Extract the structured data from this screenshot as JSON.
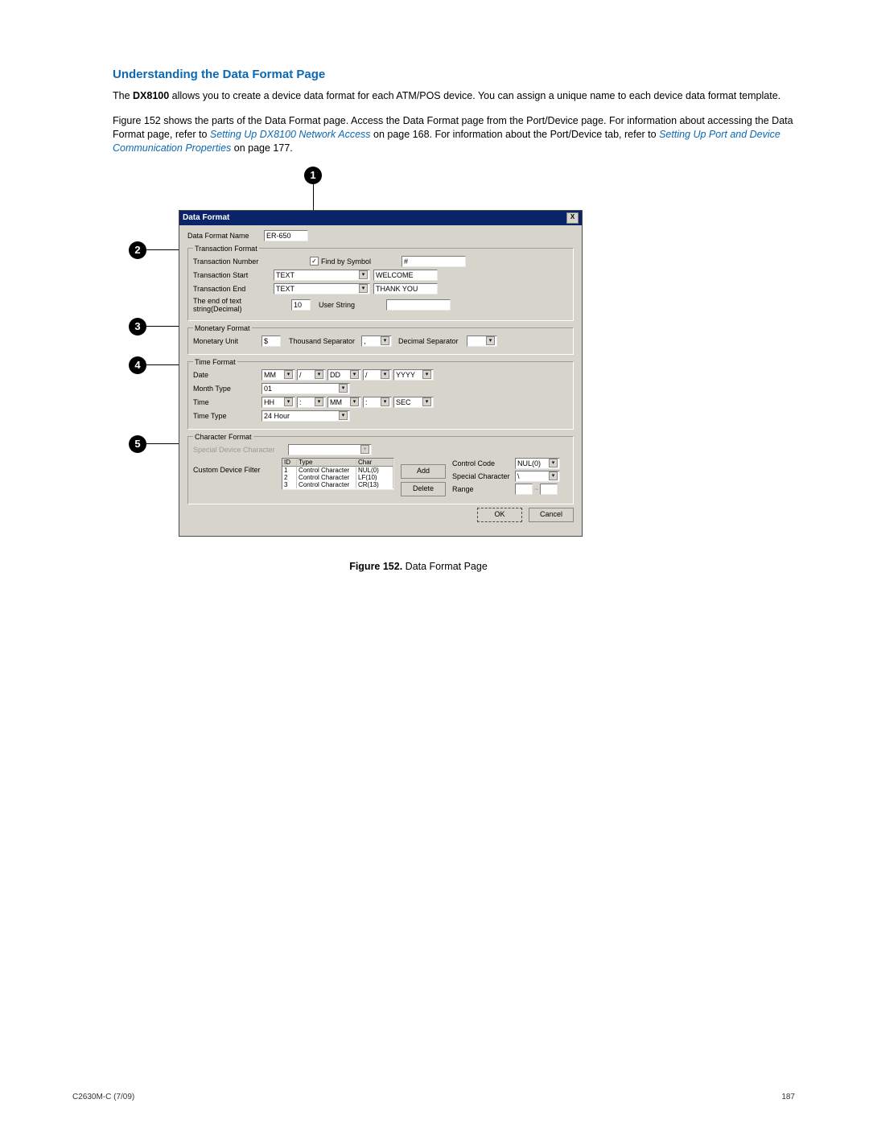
{
  "doc": {
    "section_title": "Understanding the Data Format Page",
    "para1_prefix": "The ",
    "para1_bold": "DX8100",
    "para1_rest": " allows you to create a device data format for each ATM/POS device. You can assign a unique name to each device data format template.",
    "para2_a": "Figure 152 shows the parts of the Data Format page. Access the Data Format page from the Port/Device page. For information about accessing the Data Format page, refer to ",
    "para2_link1": "Setting Up DX8100 Network Access",
    "para2_b": " on page 168. For information about the Port/Device tab, refer to ",
    "para2_link2": "Setting Up Port and Device Communication Properties",
    "para2_c": " on page 177.",
    "figcap_bold": "Figure 152.",
    "figcap_text": "  Data Format Page",
    "footer_left": "C2630M-C (7/09)",
    "footer_right": "187"
  },
  "callouts": {
    "c1": "1",
    "c2": "2",
    "c3": "3",
    "c4": "4",
    "c5": "5"
  },
  "dlg": {
    "title": "Data Format",
    "close": "X",
    "name_label": "Data Format Name",
    "name_value": "ER-650",
    "tf": {
      "legend": "Transaction Format",
      "tn_label": "Transaction Number",
      "find_label": "Find by Symbol",
      "find_value": "#",
      "ts_label": "Transaction Start",
      "ts_combo": "TEXT",
      "ts_value": "WELCOME",
      "te_label": "Transaction End",
      "te_combo": "TEXT",
      "te_value": "THANK YOU",
      "end_label": "The end of text string(Decimal)",
      "end_value": "10",
      "user_string": "User String",
      "user_value": ""
    },
    "mf": {
      "legend": "Monetary Format",
      "mu_label": "Monetary Unit",
      "mu_value": "$",
      "ts_label": "Thousand Separator",
      "ts_value": ",",
      "ds_label": "Decimal Separator",
      "ds_value": ""
    },
    "tm": {
      "legend": "Time Format",
      "date_label": "Date",
      "d1": "MM",
      "sep1": "/",
      "d2": "DD",
      "sep2": "/",
      "d3": "YYYY",
      "mt_label": "Month Type",
      "mt_value": "01",
      "time_label": "Time",
      "t1": "HH",
      "tsep1": ":",
      "t2": "MM",
      "tsep2": ":",
      "t3": "SEC",
      "tt_label": "Time Type",
      "tt_value": "24 Hour"
    },
    "cf": {
      "legend": "Character Format",
      "sdc_label": "Special Device Character",
      "cdf_label": "Custom Device Filter",
      "table": {
        "h_id": "ID",
        "h_type": "Type",
        "h_char": "Char",
        "rows": [
          {
            "id": "1",
            "type": "Control Character",
            "char": "NUL(0)"
          },
          {
            "id": "2",
            "type": "Control Character",
            "char": "LF(10)"
          },
          {
            "id": "3",
            "type": "Control Character",
            "char": "CR(13)"
          }
        ]
      },
      "add": "Add",
      "delete": "Delete",
      "cc_label": "Control Code",
      "cc_value": "NUL(0)",
      "sc_label": "Special Character",
      "sc_value": "\\",
      "range_label": "Range"
    },
    "ok": "OK",
    "cancel": "Cancel"
  }
}
